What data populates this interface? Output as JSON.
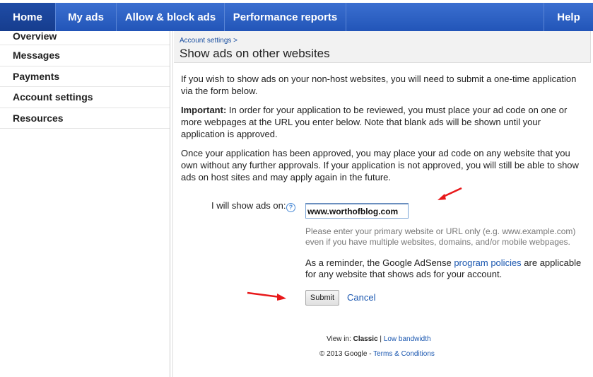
{
  "nav": {
    "tabs": [
      {
        "label": "Home"
      },
      {
        "label": "My ads"
      },
      {
        "label": "Allow & block ads"
      },
      {
        "label": "Performance reports"
      }
    ],
    "help": "Help"
  },
  "sidebar": {
    "items": [
      {
        "label": "Overview"
      },
      {
        "label": "Messages"
      },
      {
        "label": "Payments"
      },
      {
        "label": "Account settings"
      },
      {
        "label": "Resources"
      }
    ]
  },
  "header": {
    "breadcrumb": "Account settings",
    "breadcrumb_sep": " >",
    "title": "Show ads on other websites"
  },
  "content": {
    "p1": "If you wish to show ads on your non-host websites, you will need to submit a one-time application via the form below.",
    "p2_bold": "Important:",
    "p2_rest": " In order for your application to be reviewed, you must place your ad code on one or more webpages at the URL you enter below. Note that blank ads will be shown until your application is approved.",
    "p3": "Once your application has been approved, you may place your ad code on any website that you own without any further approvals. If your application is not approved, you will still be able to show ads on host sites and may apply again in the future."
  },
  "form": {
    "label": "I will show ads on:",
    "help_icon": "?",
    "url_value": "www.worthofblog.com",
    "hint": "Please enter your primary website or URL only (e.g. www.example.com) even if you have multiple websites, domains, and/or mobile webpages.",
    "reminder_pre": "As a reminder, the Google AdSense ",
    "reminder_link": "program policies",
    "reminder_post": " are applicable for any website that shows ads for your account.",
    "submit": "Submit",
    "cancel": "Cancel"
  },
  "footer": {
    "view_in": "View in: ",
    "classic": "Classic",
    "sep": " | ",
    "low_bandwidth": "Low bandwidth",
    "copyright": "© 2013 Google - ",
    "terms": "Terms & Conditions"
  },
  "colors": {
    "nav_bg": "#2a5fc2",
    "link": "#1a57b0",
    "arrow": "#e8181a"
  }
}
